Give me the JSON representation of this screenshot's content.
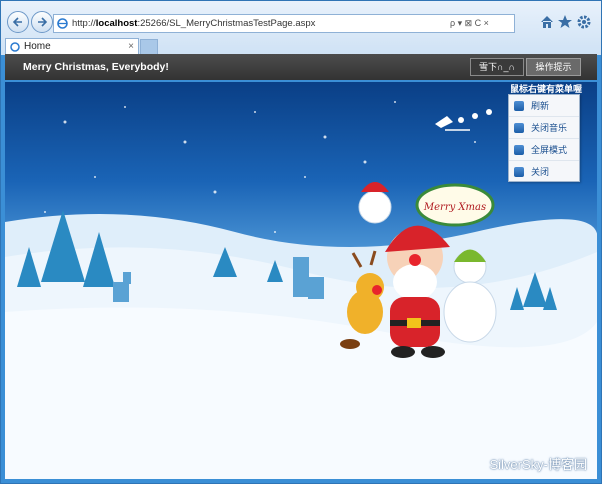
{
  "browser": {
    "url_prefix": "http://",
    "url_host": "localhost",
    "url_rest": ":25266/SL_MerryChristmasTestPage.aspx",
    "addr_controls": "ρ ▾ ⊠ C ×",
    "tab_label": "Home",
    "tab_close": "×"
  },
  "app": {
    "title": "Merry Christmas, Everybody!",
    "button_snow": "雪下∩_∩",
    "button_help": "操作提示"
  },
  "scene": {
    "menu_hint": "鼠标右键有菜单喔",
    "sign_text": "Merry Xmas",
    "context_menu": [
      {
        "label": "刷新",
        "icon": "refresh-icon"
      },
      {
        "label": "关闭音乐",
        "icon": "music-icon"
      },
      {
        "label": "全屏模式",
        "icon": "fullscreen-icon"
      },
      {
        "label": "关闭",
        "icon": "close-icon"
      }
    ],
    "watermark": "SilverSky-博客园"
  },
  "colors": {
    "header_bg": "#3a3a3a",
    "sky_top": "#0a3f86",
    "menu_text": "#1b4f8f"
  }
}
